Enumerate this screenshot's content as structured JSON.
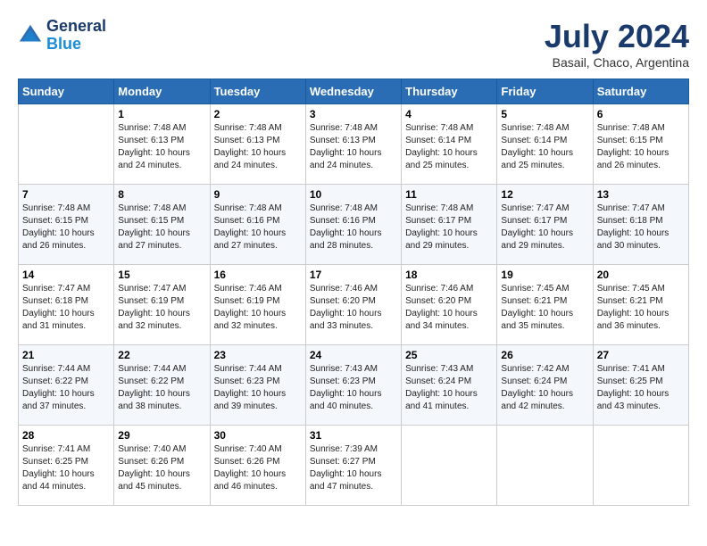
{
  "header": {
    "logo_line1": "General",
    "logo_line2": "Blue",
    "month_title": "July 2024",
    "subtitle": "Basail, Chaco, Argentina"
  },
  "days_of_week": [
    "Sunday",
    "Monday",
    "Tuesday",
    "Wednesday",
    "Thursday",
    "Friday",
    "Saturday"
  ],
  "weeks": [
    [
      {
        "day": "",
        "sunrise": "",
        "sunset": "",
        "daylight": ""
      },
      {
        "day": "1",
        "sunrise": "Sunrise: 7:48 AM",
        "sunset": "Sunset: 6:13 PM",
        "daylight": "Daylight: 10 hours and 24 minutes."
      },
      {
        "day": "2",
        "sunrise": "Sunrise: 7:48 AM",
        "sunset": "Sunset: 6:13 PM",
        "daylight": "Daylight: 10 hours and 24 minutes."
      },
      {
        "day": "3",
        "sunrise": "Sunrise: 7:48 AM",
        "sunset": "Sunset: 6:13 PM",
        "daylight": "Daylight: 10 hours and 24 minutes."
      },
      {
        "day": "4",
        "sunrise": "Sunrise: 7:48 AM",
        "sunset": "Sunset: 6:14 PM",
        "daylight": "Daylight: 10 hours and 25 minutes."
      },
      {
        "day": "5",
        "sunrise": "Sunrise: 7:48 AM",
        "sunset": "Sunset: 6:14 PM",
        "daylight": "Daylight: 10 hours and 25 minutes."
      },
      {
        "day": "6",
        "sunrise": "Sunrise: 7:48 AM",
        "sunset": "Sunset: 6:15 PM",
        "daylight": "Daylight: 10 hours and 26 minutes."
      }
    ],
    [
      {
        "day": "7",
        "sunrise": "Sunrise: 7:48 AM",
        "sunset": "Sunset: 6:15 PM",
        "daylight": "Daylight: 10 hours and 26 minutes."
      },
      {
        "day": "8",
        "sunrise": "Sunrise: 7:48 AM",
        "sunset": "Sunset: 6:15 PM",
        "daylight": "Daylight: 10 hours and 27 minutes."
      },
      {
        "day": "9",
        "sunrise": "Sunrise: 7:48 AM",
        "sunset": "Sunset: 6:16 PM",
        "daylight": "Daylight: 10 hours and 27 minutes."
      },
      {
        "day": "10",
        "sunrise": "Sunrise: 7:48 AM",
        "sunset": "Sunset: 6:16 PM",
        "daylight": "Daylight: 10 hours and 28 minutes."
      },
      {
        "day": "11",
        "sunrise": "Sunrise: 7:48 AM",
        "sunset": "Sunset: 6:17 PM",
        "daylight": "Daylight: 10 hours and 29 minutes."
      },
      {
        "day": "12",
        "sunrise": "Sunrise: 7:47 AM",
        "sunset": "Sunset: 6:17 PM",
        "daylight": "Daylight: 10 hours and 29 minutes."
      },
      {
        "day": "13",
        "sunrise": "Sunrise: 7:47 AM",
        "sunset": "Sunset: 6:18 PM",
        "daylight": "Daylight: 10 hours and 30 minutes."
      }
    ],
    [
      {
        "day": "14",
        "sunrise": "Sunrise: 7:47 AM",
        "sunset": "Sunset: 6:18 PM",
        "daylight": "Daylight: 10 hours and 31 minutes."
      },
      {
        "day": "15",
        "sunrise": "Sunrise: 7:47 AM",
        "sunset": "Sunset: 6:19 PM",
        "daylight": "Daylight: 10 hours and 32 minutes."
      },
      {
        "day": "16",
        "sunrise": "Sunrise: 7:46 AM",
        "sunset": "Sunset: 6:19 PM",
        "daylight": "Daylight: 10 hours and 32 minutes."
      },
      {
        "day": "17",
        "sunrise": "Sunrise: 7:46 AM",
        "sunset": "Sunset: 6:20 PM",
        "daylight": "Daylight: 10 hours and 33 minutes."
      },
      {
        "day": "18",
        "sunrise": "Sunrise: 7:46 AM",
        "sunset": "Sunset: 6:20 PM",
        "daylight": "Daylight: 10 hours and 34 minutes."
      },
      {
        "day": "19",
        "sunrise": "Sunrise: 7:45 AM",
        "sunset": "Sunset: 6:21 PM",
        "daylight": "Daylight: 10 hours and 35 minutes."
      },
      {
        "day": "20",
        "sunrise": "Sunrise: 7:45 AM",
        "sunset": "Sunset: 6:21 PM",
        "daylight": "Daylight: 10 hours and 36 minutes."
      }
    ],
    [
      {
        "day": "21",
        "sunrise": "Sunrise: 7:44 AM",
        "sunset": "Sunset: 6:22 PM",
        "daylight": "Daylight: 10 hours and 37 minutes."
      },
      {
        "day": "22",
        "sunrise": "Sunrise: 7:44 AM",
        "sunset": "Sunset: 6:22 PM",
        "daylight": "Daylight: 10 hours and 38 minutes."
      },
      {
        "day": "23",
        "sunrise": "Sunrise: 7:44 AM",
        "sunset": "Sunset: 6:23 PM",
        "daylight": "Daylight: 10 hours and 39 minutes."
      },
      {
        "day": "24",
        "sunrise": "Sunrise: 7:43 AM",
        "sunset": "Sunset: 6:23 PM",
        "daylight": "Daylight: 10 hours and 40 minutes."
      },
      {
        "day": "25",
        "sunrise": "Sunrise: 7:43 AM",
        "sunset": "Sunset: 6:24 PM",
        "daylight": "Daylight: 10 hours and 41 minutes."
      },
      {
        "day": "26",
        "sunrise": "Sunrise: 7:42 AM",
        "sunset": "Sunset: 6:24 PM",
        "daylight": "Daylight: 10 hours and 42 minutes."
      },
      {
        "day": "27",
        "sunrise": "Sunrise: 7:41 AM",
        "sunset": "Sunset: 6:25 PM",
        "daylight": "Daylight: 10 hours and 43 minutes."
      }
    ],
    [
      {
        "day": "28",
        "sunrise": "Sunrise: 7:41 AM",
        "sunset": "Sunset: 6:25 PM",
        "daylight": "Daylight: 10 hours and 44 minutes."
      },
      {
        "day": "29",
        "sunrise": "Sunrise: 7:40 AM",
        "sunset": "Sunset: 6:26 PM",
        "daylight": "Daylight: 10 hours and 45 minutes."
      },
      {
        "day": "30",
        "sunrise": "Sunrise: 7:40 AM",
        "sunset": "Sunset: 6:26 PM",
        "daylight": "Daylight: 10 hours and 46 minutes."
      },
      {
        "day": "31",
        "sunrise": "Sunrise: 7:39 AM",
        "sunset": "Sunset: 6:27 PM",
        "daylight": "Daylight: 10 hours and 47 minutes."
      },
      {
        "day": "",
        "sunrise": "",
        "sunset": "",
        "daylight": ""
      },
      {
        "day": "",
        "sunrise": "",
        "sunset": "",
        "daylight": ""
      },
      {
        "day": "",
        "sunrise": "",
        "sunset": "",
        "daylight": ""
      }
    ]
  ]
}
